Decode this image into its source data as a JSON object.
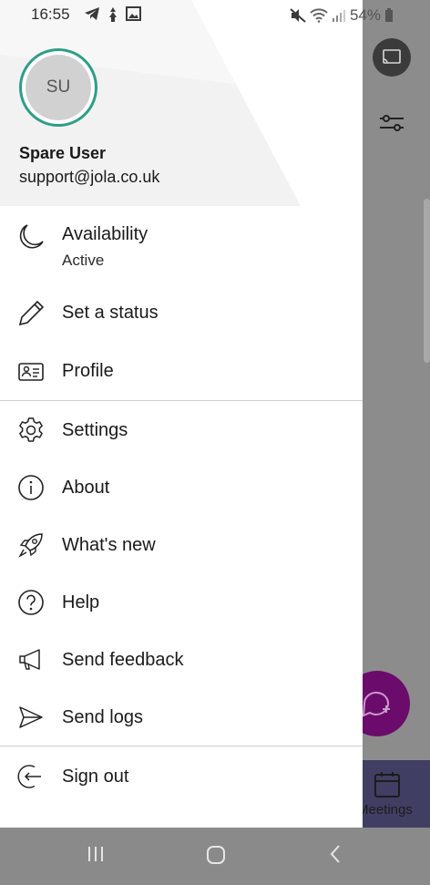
{
  "status_bar": {
    "time": "16:55",
    "battery": "54%"
  },
  "drawer": {
    "avatar_initials": "SU",
    "user_name": "Spare User",
    "user_email": "support@jola.co.uk",
    "availability": {
      "label": "Availability",
      "value": "Active"
    },
    "items": [
      {
        "label": "Set a status",
        "icon": "pencil-icon"
      },
      {
        "label": "Profile",
        "icon": "profile-card-icon"
      },
      {
        "label": "Settings",
        "icon": "gear-icon"
      },
      {
        "label": "About",
        "icon": "info-icon"
      },
      {
        "label": "What's new",
        "icon": "rocket-icon"
      },
      {
        "label": "Help",
        "icon": "question-icon"
      },
      {
        "label": "Send feedback",
        "icon": "megaphone-icon"
      },
      {
        "label": "Send logs",
        "icon": "send-icon"
      },
      {
        "label": "Sign out",
        "icon": "sign-out-icon"
      }
    ]
  },
  "background_app": {
    "bottom_nav_label": "Meetings"
  },
  "colors": {
    "avatar_ring": "#2e9e86",
    "fab": "#6b0b6b",
    "scrim": "#8c8c8c"
  }
}
